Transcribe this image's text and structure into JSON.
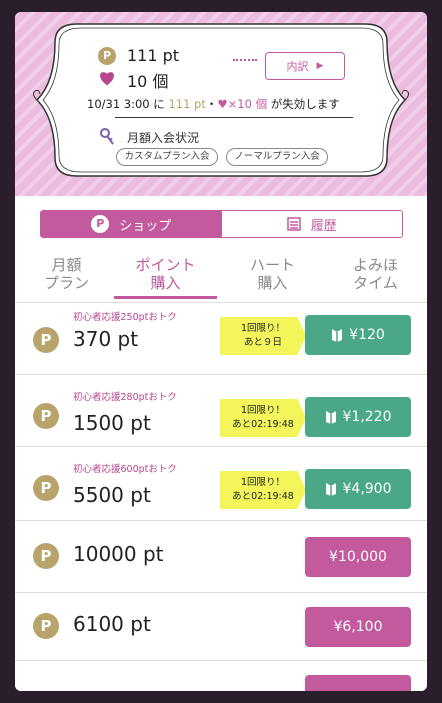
{
  "summary": {
    "points": "111 pt",
    "hearts": "10 個",
    "breakdown_label": "内訳",
    "breakdown_arrow": "▶",
    "expire_date": "10/31 3:00",
    "expire_ni": "に",
    "expire_pt": "111 pt",
    "expire_dot": "・",
    "expire_hearts": "×10 個",
    "expire_suffix": "が失効します",
    "subscription_label": "月額入会状況",
    "custom_plan": "カスタムプラン入会",
    "normal_plan": "ノーマルプラン入会"
  },
  "toggle": {
    "shop_badge": "P",
    "shop_label": "ショップ",
    "history_label": "履歴"
  },
  "tabs": [
    {
      "line1": "月額",
      "line2": "プラン"
    },
    {
      "line1": "ポイント",
      "line2": "購入"
    },
    {
      "line1": "ハート",
      "line2": "購入"
    },
    {
      "line1": "よみほ",
      "line2": "タイム"
    }
  ],
  "coin_letter": "P",
  "items": [
    {
      "promo": "初心者応援250ptおトク",
      "points": "370 pt",
      "badge_line1": "1回限り！",
      "badge_line2": "あと９日",
      "price": "¥120"
    },
    {
      "promo": "初心者応援280ptおトク",
      "points": "1500 pt",
      "badge_line1": "1回限り！",
      "badge_line2": "あと02:19:48",
      "price": "¥1,220"
    },
    {
      "promo": "初心者応援600ptおトク",
      "points": "5500 pt",
      "badge_line1": "1回限り！",
      "badge_line2": "あと02:19:48",
      "price": "¥4,900"
    },
    {
      "points": "10000 pt",
      "price": "¥10,000"
    },
    {
      "points": "6100 pt",
      "price": "¥6,100"
    }
  ],
  "colors": {
    "accent": "#c35a9d",
    "gold": "#b8a36a",
    "green": "#4aa888",
    "badge": "#f3f55a"
  }
}
